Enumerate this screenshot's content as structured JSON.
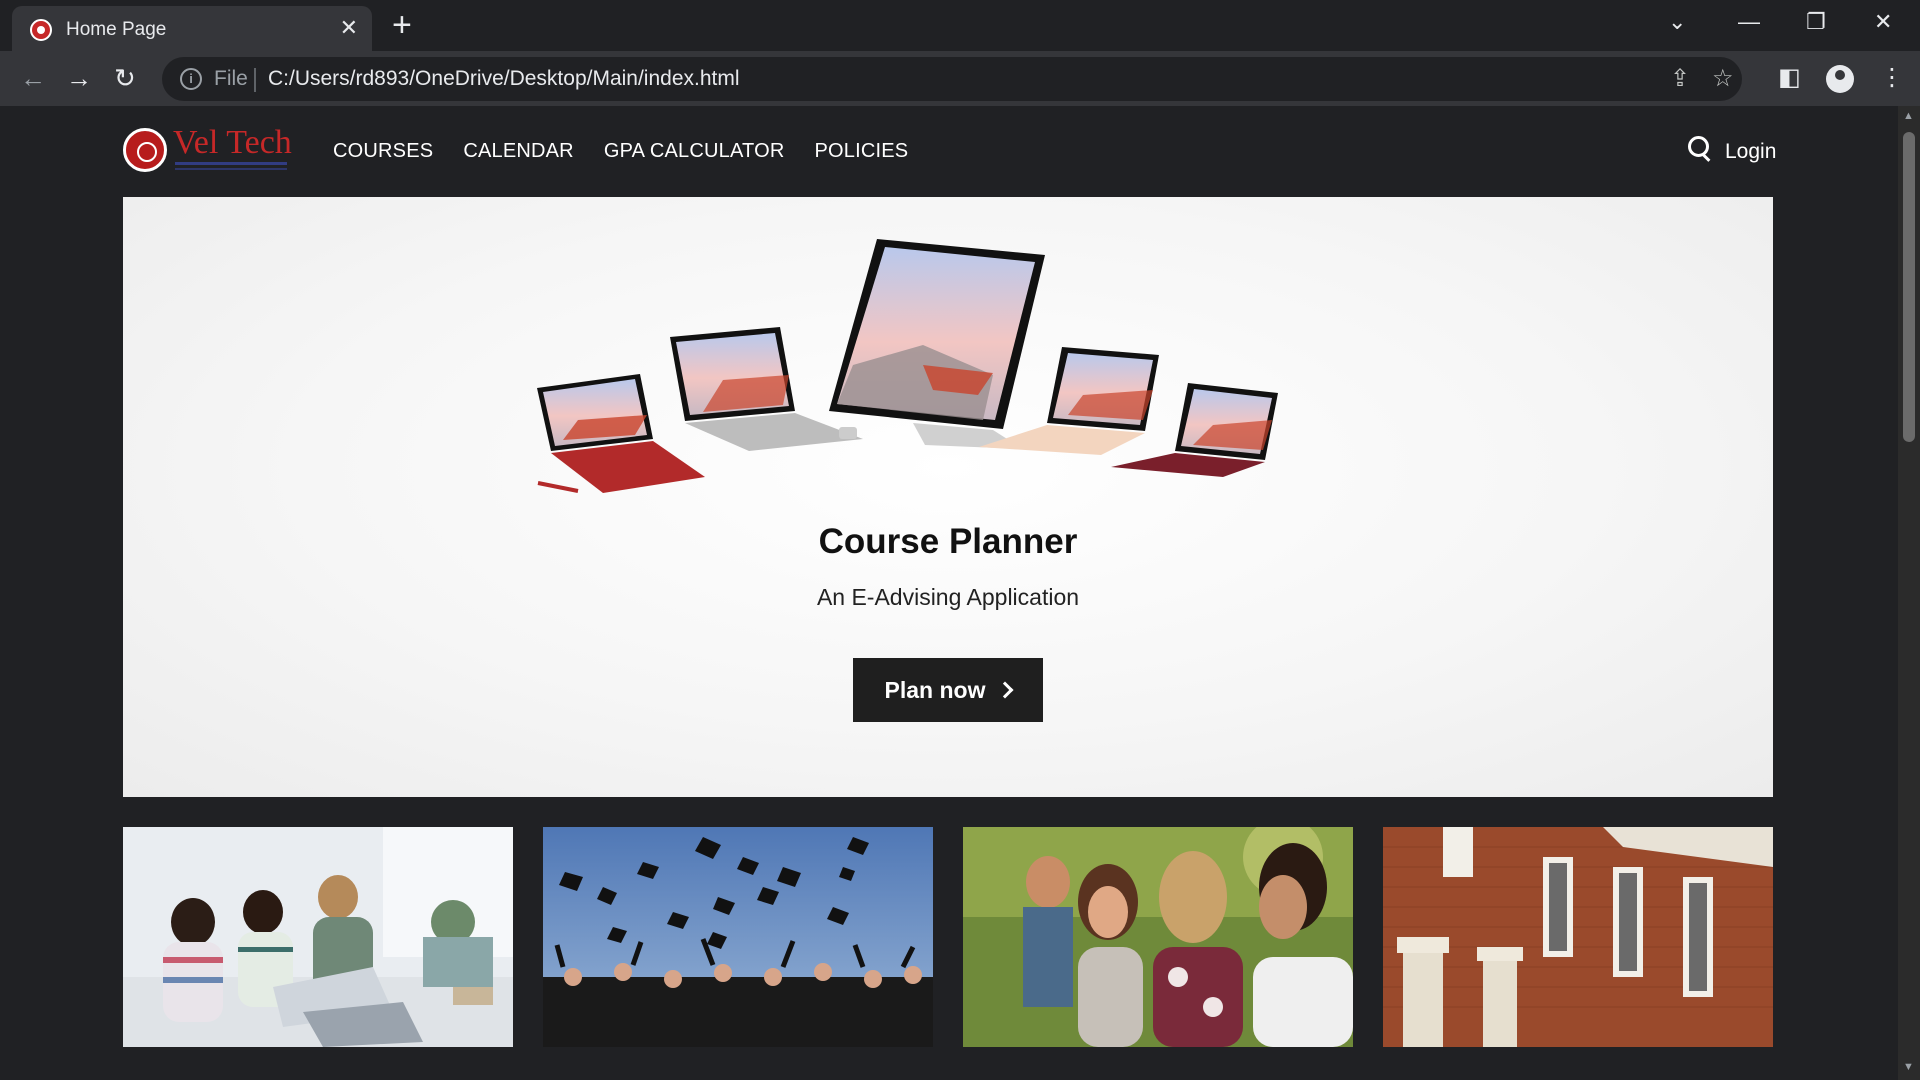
{
  "browser": {
    "tab_title": "Home Page",
    "url_scheme": "File",
    "url": "C:/Users/rd893/OneDrive/Desktop/Main/index.html"
  },
  "site": {
    "logo_text": "Vel Tech",
    "nav": [
      "COURSES",
      "CALENDAR",
      "GPA CALCULATOR",
      "POLICIES"
    ],
    "login_label": "Login"
  },
  "hero": {
    "title": "Course Planner",
    "subtitle": "An E-Advising Application",
    "cta_label": "Plan now"
  },
  "colors": {
    "page_bg": "#202124",
    "hero_bg": "#f3f3f3",
    "cta_bg": "#1f1f1f",
    "brand_red": "#c62828"
  },
  "icons": [
    "favicon-icon",
    "close-icon",
    "plus-icon",
    "chevron-down-icon",
    "minimize-icon",
    "restore-icon",
    "back-icon",
    "forward-icon",
    "reload-icon",
    "info-icon",
    "share-icon",
    "star-icon",
    "side-panel-icon",
    "profile-icon",
    "kebab-menu-icon",
    "search-icon",
    "chevron-right-icon"
  ]
}
